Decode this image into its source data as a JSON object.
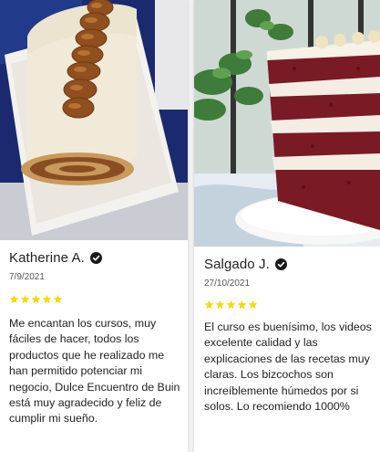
{
  "reviews": [
    {
      "name": "Katherine A.",
      "date": "7/9/2021",
      "rating": 5,
      "text": "Me encantan los cursos, muy fáciles de hacer, todos los productos que he realizado me han permitido potenciar mi negocio, Dulce Encuentro de Buin está muy agradecido y feliz de cumplir mi sueño."
    },
    {
      "name": "Salgado J.",
      "date": "27/10/2021",
      "rating": 5,
      "text": "El curso es buenísimo, los videos excelente calidad y las explicaciones de las recetas muy claras. Los bizcochos son increíblemente húmedos por si solos. Lo recomiendo 1000%"
    }
  ],
  "colors": {
    "star": "#f5d90a",
    "verified": "#1a1a1a",
    "text": "#222222"
  },
  "icons": {
    "verified": "verified-check-icon",
    "star": "star-icon"
  }
}
